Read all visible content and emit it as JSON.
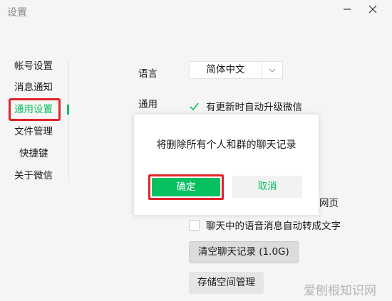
{
  "window": {
    "title": "设置"
  },
  "sidebar": {
    "items": [
      {
        "label": "帐号设置"
      },
      {
        "label": "消息通知"
      },
      {
        "label": "通用设置"
      },
      {
        "label": "文件管理"
      },
      {
        "label": "快捷键"
      },
      {
        "label": "关于微信"
      }
    ],
    "active_index": 2
  },
  "settings": {
    "language_label": "语言",
    "language_value": "简体中文",
    "general_label": "通用",
    "auto_upgrade_label": "有更新时自动升级微信",
    "auto_upgrade_checked": true,
    "partial_hidden_text": "网页",
    "voice_to_text_label": "聊天中的语音消息自动转成文字",
    "voice_to_text_checked": false,
    "clear_history_button": "清空聊天记录 (1.0G)",
    "storage_button": "存储空间管理"
  },
  "dialog": {
    "message": "将删除所有个人和群的聊天记录",
    "confirm": "确定",
    "cancel": "取消"
  },
  "watermark": "爱刨根知识网",
  "colors": {
    "accent": "#07c160",
    "highlight": "#e0242b"
  }
}
